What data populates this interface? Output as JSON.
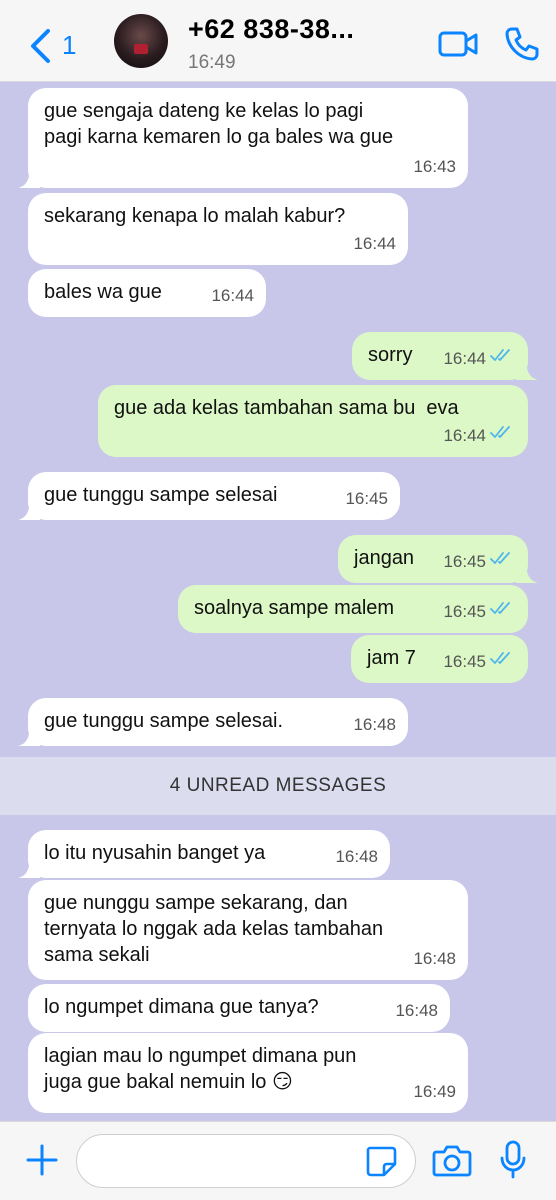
{
  "header": {
    "back_count": "1",
    "contact_name": "+62 838-38...",
    "last_seen": "16:49"
  },
  "colors": {
    "accent": "#0a84ff",
    "background": "#c8c7ea",
    "incoming": "#ffffff",
    "outgoing": "#dcf8c6",
    "read_ticks": "#4fb6ec"
  },
  "messages": [
    {
      "dir": "in",
      "text": "gue sengaja dateng ke kelas lo pagi\npagi karna kemaren lo ga bales wa gue",
      "time": "16:43"
    },
    {
      "dir": "in",
      "text": "sekarang kenapa lo malah kabur?",
      "time": "16:44"
    },
    {
      "dir": "in",
      "text": "bales wa gue",
      "time": "16:44"
    },
    {
      "dir": "out",
      "text": "sorry",
      "time": "16:44"
    },
    {
      "dir": "out",
      "text": "gue ada kelas tambahan sama bu  eva",
      "time": "16:44"
    },
    {
      "dir": "in",
      "text": "gue tunggu sampe selesai",
      "time": "16:45"
    },
    {
      "dir": "out",
      "text": "jangan",
      "time": "16:45"
    },
    {
      "dir": "out",
      "text": "soalnya sampe malem",
      "time": "16:45"
    },
    {
      "dir": "out",
      "text": "jam 7",
      "time": "16:45"
    },
    {
      "dir": "in",
      "text": "gue tunggu sampe selesai.",
      "time": "16:48"
    },
    {
      "dir": "in",
      "text": "lo itu nyusahin banget ya",
      "time": "16:48"
    },
    {
      "dir": "in",
      "text": "gue nunggu sampe sekarang, dan\nternyata lo nggak ada kelas tambahan\nsama sekali",
      "time": "16:48"
    },
    {
      "dir": "in",
      "text": "lo ngumpet dimana gue tanya?",
      "time": "16:48"
    },
    {
      "dir": "in",
      "text": "lagian mau lo ngumpet dimana pun\njuga gue bakal nemuin lo 😏",
      "time": "16:49"
    }
  ],
  "unread_banner": "4 UNREAD MESSAGES",
  "composer": {
    "placeholder": ""
  }
}
